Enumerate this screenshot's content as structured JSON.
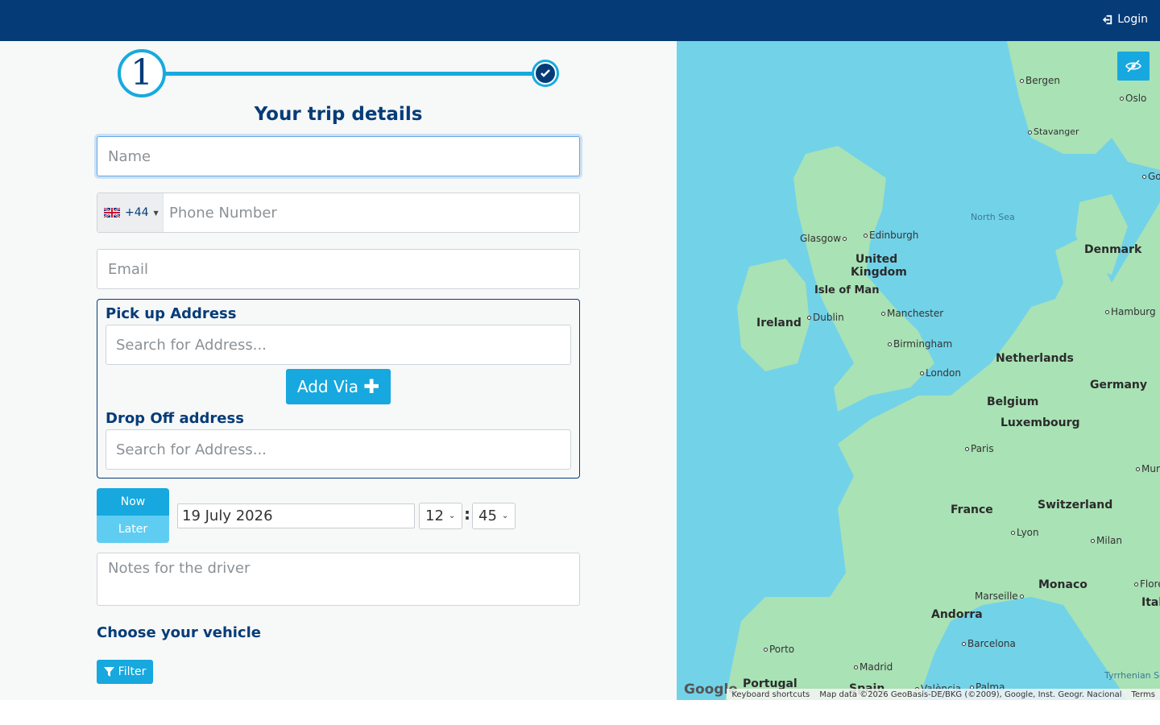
{
  "header": {
    "login_label": "Login"
  },
  "stepper": {
    "current_step": "1"
  },
  "form": {
    "title": "Your trip details",
    "name_placeholder": "Name",
    "phone": {
      "dial_code": "+44",
      "placeholder": "Phone Number",
      "flag": "uk-flag-icon"
    },
    "email_placeholder": "Email",
    "pickup": {
      "label": "Pick up Address",
      "placeholder": "Search for Address..."
    },
    "add_via_label": "Add Via",
    "dropoff": {
      "label": "Drop Off address",
      "placeholder": "Search for Address..."
    },
    "when": {
      "now_label": "Now",
      "later_label": "Later"
    },
    "date_value": "19 July 2026",
    "hour_value": "12",
    "minute_value": "45",
    "time_separator": ":",
    "notes_placeholder": "Notes for the driver",
    "vehicle_heading": "Choose your vehicle",
    "filter_label": "Filter"
  },
  "map": {
    "cities": [
      "Bergen",
      "Oslo",
      "Stavanger",
      "Go",
      "Edinburgh",
      "Glasgow",
      "Isle of Man",
      "Dublin",
      "Manchester",
      "Hamburg",
      "Birmingham",
      "London",
      "Paris",
      "Mun",
      "Lyon",
      "Milan",
      "Flore",
      "Marseille",
      "Barcelona",
      "Porto",
      "Madrid",
      "València",
      "Palma"
    ],
    "countries": [
      "United Kingdom",
      "Ireland",
      "Denmark",
      "Netherlands",
      "Germany",
      "Belgium",
      "Luxembourg",
      "France",
      "Switzerland",
      "Monaco",
      "Andorra",
      "Portugal",
      "Spain",
      "Ital"
    ],
    "seas": [
      "North Sea",
      "Tyrrhenian Sea"
    ],
    "logo": "Google",
    "footer": {
      "shortcuts": "Keyboard shortcuts",
      "attribution": "Map data ©2026 GeoBasis-DE/BKG (©2009), Google, Inst. Geogr. Nacional",
      "terms": "Terms"
    },
    "colors": {
      "water": "#72d2e8",
      "land": "#a9e2b5"
    }
  },
  "colors": {
    "navy": "#053c78",
    "accent": "#16a8de"
  }
}
